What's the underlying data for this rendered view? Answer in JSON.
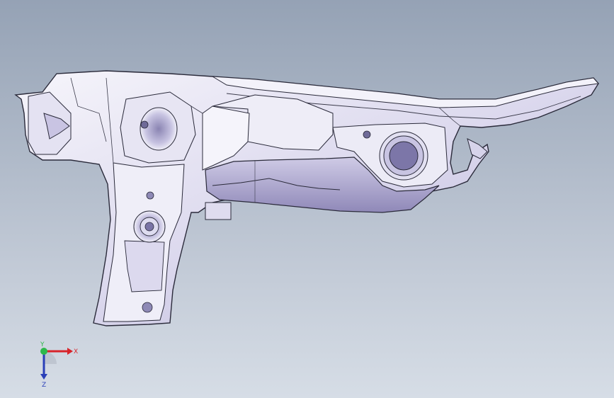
{
  "viewport": {
    "background_top": "#95a2b5",
    "background_bottom": "#d6dde6"
  },
  "model": {
    "icon": "sheet-metal-bracket-part",
    "edge_color": "#2a2a3a",
    "face_color": "#e6e4f2",
    "shadow_color": "#a9a4c8"
  },
  "triad": {
    "x_label": "X",
    "y_label": "Y",
    "z_label": "Z",
    "x_color": "#d8242b",
    "y_color": "#2db84a",
    "z_color": "#2a3fb8"
  }
}
